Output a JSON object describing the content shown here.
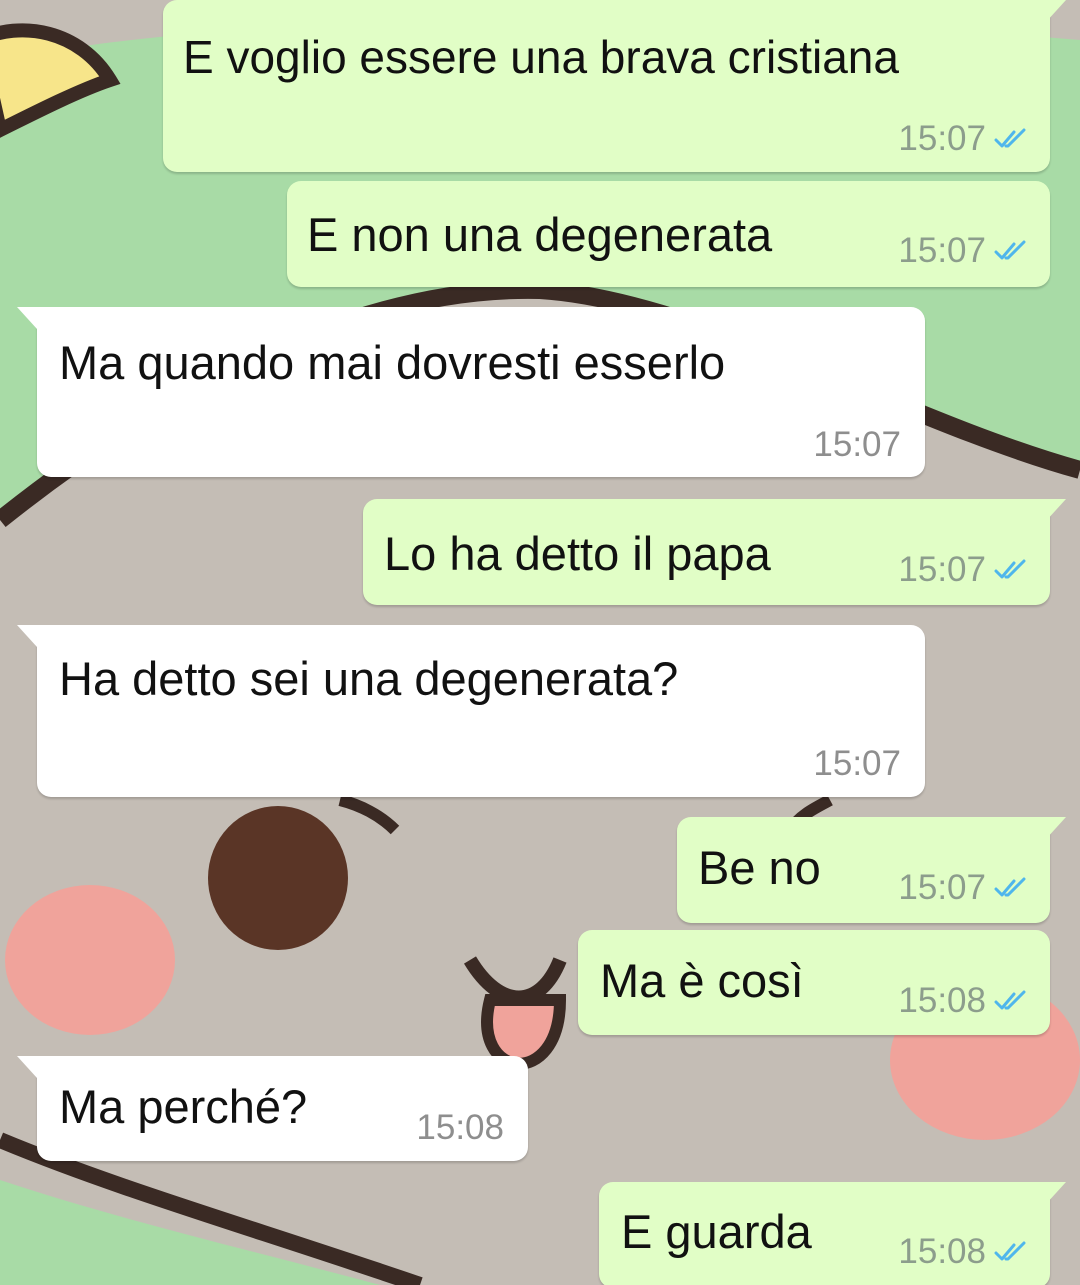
{
  "messages": [
    {
      "direction": "out",
      "text": "E voglio essere una brava cristiana",
      "time": "15:07",
      "status": "read-double-check"
    },
    {
      "direction": "out",
      "text": "E non una degenerata",
      "time": "15:07",
      "status": "read-double-check"
    },
    {
      "direction": "in",
      "text": "Ma quando mai dovresti esserlo",
      "time": "15:07"
    },
    {
      "direction": "out",
      "text": "Lo ha detto il papa",
      "time": "15:07",
      "status": "read-double-check"
    },
    {
      "direction": "in",
      "text": "Ha detto sei una degenerata?",
      "time": "15:07"
    },
    {
      "direction": "out",
      "text": "Be no",
      "time": "15:07",
      "status": "read-double-check"
    },
    {
      "direction": "out",
      "text": "Ma è così",
      "time": "15:08",
      "status": "read-double-check"
    },
    {
      "direction": "in",
      "text": "Ma perché?",
      "time": "15:08"
    },
    {
      "direction": "out",
      "text": "E guarda",
      "time": "15:08",
      "status": "read-double-check"
    }
  ],
  "colors": {
    "outgoing_bubble": "#e1fec6",
    "incoming_bubble": "#ffffff",
    "read_tick": "#4fb6ec",
    "timestamp_out": "#8c9d8c",
    "timestamp_in": "#8e8e8e"
  },
  "wallpaper": "cartoon-bear-face"
}
